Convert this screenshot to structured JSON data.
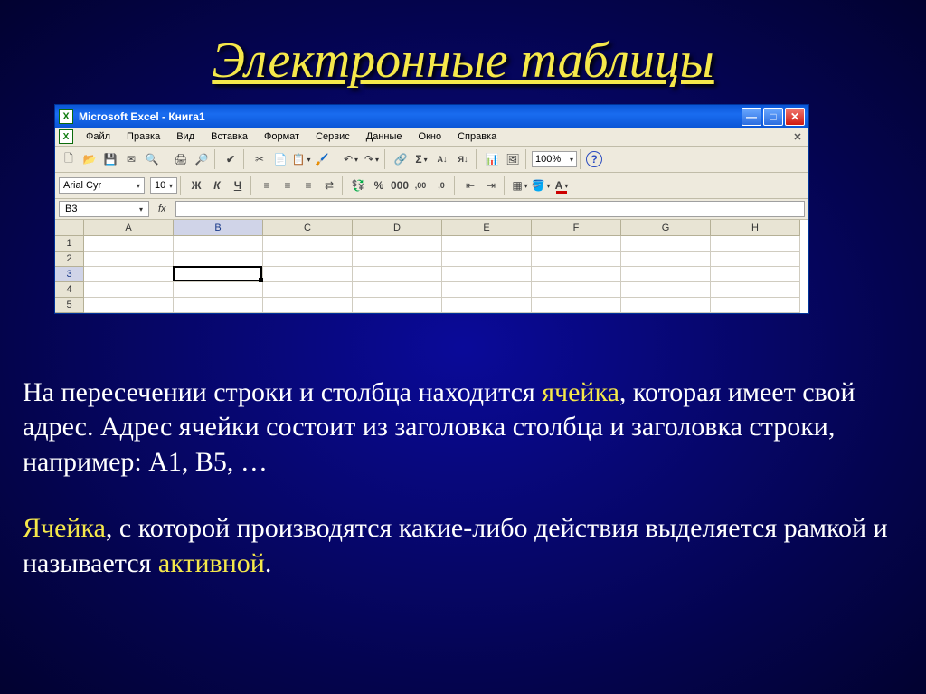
{
  "slide": {
    "title": "Электронные таблицы"
  },
  "titlebar": {
    "app_doc": "Microsoft Excel - Книга1"
  },
  "menu": {
    "file": "Файл",
    "edit": "Правка",
    "view": "Вид",
    "insert": "Вставка",
    "format": "Формат",
    "tools": "Сервис",
    "data": "Данные",
    "window": "Окно",
    "help": "Справка"
  },
  "toolbar": {
    "zoom": "100%"
  },
  "fmt": {
    "font_name": "Arial Cyr",
    "font_size": "10",
    "bold": "Ж",
    "italic": "К",
    "underline": "Ч"
  },
  "formula": {
    "name_box": "B3",
    "fx": "fx"
  },
  "grid": {
    "cols": [
      "A",
      "B",
      "C",
      "D",
      "E",
      "F",
      "G",
      "H"
    ],
    "rows": [
      "1",
      "2",
      "3",
      "4",
      "5"
    ],
    "active": {
      "col": "B",
      "row": "3"
    }
  },
  "text": {
    "p1a": "На пересечении строки и столбца находится ",
    "p1b": "ячейка",
    "p1c": ", которая имеет свой адрес. Адрес ячейки состоит из заголовка столбца  и заголовка строки, например: А1, В5, …",
    "p2a": "Ячейка",
    "p2b": ",  с которой производятся какие-либо действия выделяется рамкой и называется ",
    "p2c": "активной",
    "p2d": "."
  }
}
